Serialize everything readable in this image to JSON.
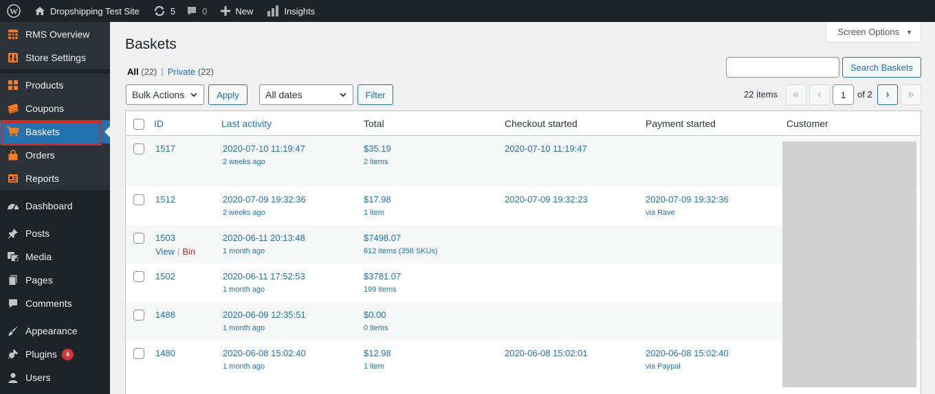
{
  "adminbar": {
    "site_name": "Dropshipping Test Site",
    "updates_count": "5",
    "comments_count": "0",
    "new_label": "New",
    "insights_label": "Insights"
  },
  "sidebar": {
    "rms_items": [
      {
        "label": "RMS Overview",
        "icon": "grid-icon"
      },
      {
        "label": "Store Settings",
        "icon": "sliders-icon"
      }
    ],
    "store_items": [
      {
        "label": "Products",
        "icon": "products-icon"
      },
      {
        "label": "Coupons",
        "icon": "coupons-icon"
      },
      {
        "label": "Baskets",
        "icon": "cart-icon",
        "current": true
      },
      {
        "label": "Orders",
        "icon": "bag-icon"
      },
      {
        "label": "Reports",
        "icon": "reports-icon"
      }
    ],
    "wp_items": [
      {
        "label": "Dashboard"
      },
      {
        "label": "Posts"
      },
      {
        "label": "Media"
      },
      {
        "label": "Pages"
      },
      {
        "label": "Comments"
      },
      {
        "label": "Appearance"
      },
      {
        "label": "Plugins",
        "badge": "4"
      },
      {
        "label": "Users"
      }
    ]
  },
  "main": {
    "screen_options": "Screen Options",
    "title": "Baskets",
    "views": {
      "all_label": "All",
      "all_count": "(22)",
      "private_label": "Private",
      "private_count": "(22)",
      "separator": "|"
    },
    "search_button": "Search Baskets",
    "bulk_actions": "Bulk Actions",
    "apply": "Apply",
    "date_filter": "All dates",
    "filter": "Filter",
    "items_count": "22 items",
    "pagination": {
      "first": "«",
      "prev": "‹",
      "current": "1",
      "of": "of 2",
      "next": "›",
      "last": "»"
    }
  },
  "table": {
    "columns": [
      "ID",
      "Last activity",
      "Total",
      "Checkout started",
      "Payment started",
      "Customer"
    ],
    "rows": [
      {
        "id": "1517",
        "activity": "2020-07-10 11:19:47",
        "activity_ago": "2 weeks ago",
        "total": "$35.19",
        "items": "2 items",
        "checkout": "2020-07-10 11:19:47",
        "payment": "",
        "payment_via": ""
      },
      {
        "id": "1512",
        "activity": "2020-07-09 19:32:36",
        "activity_ago": "2 weeks ago",
        "total": "$17.98",
        "items": "1 item",
        "checkout": "2020-07-09 19:32:23",
        "payment": "2020-07-09 19:32:36",
        "payment_via": "via Rave"
      },
      {
        "id": "1503",
        "activity": "2020-06-11 20:13:48",
        "activity_ago": "1 month ago",
        "total": "$7498.07",
        "items": "612 items (358 SKUs)",
        "checkout": "",
        "payment": "",
        "payment_via": "",
        "view": "View",
        "bin": "Bin"
      },
      {
        "id": "1502",
        "activity": "2020-06-11 17:52:53",
        "activity_ago": "1 month ago",
        "total": "$3781.07",
        "items": "199 items",
        "checkout": "",
        "payment": "",
        "payment_via": ""
      },
      {
        "id": "1488",
        "activity": "2020-06-09 12:35:51",
        "activity_ago": "1 month ago",
        "total": "$0.00",
        "items": "0 items",
        "checkout": "",
        "payment": "",
        "payment_via": ""
      },
      {
        "id": "1480",
        "activity": "2020-06-08 15:02:40",
        "activity_ago": "1 month ago",
        "total": "$12.98",
        "items": "1 item",
        "checkout": "2020-06-08 15:02:01",
        "payment": "2020-06-08 15:02:40",
        "payment_via": "via Paypal"
      }
    ]
  }
}
